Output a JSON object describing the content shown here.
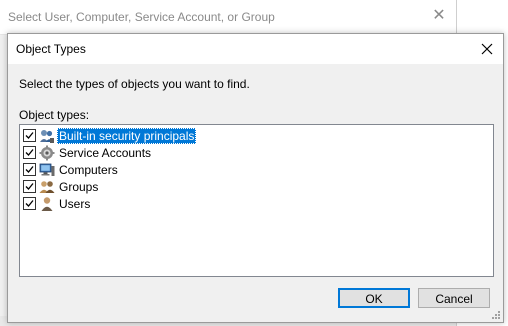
{
  "parent_window": {
    "title": "Select User, Computer, Service Account, or Group"
  },
  "dialog": {
    "title": "Object Types",
    "prompt": "Select the types of objects you want to find.",
    "list_label": "Object types:",
    "items": [
      {
        "label": "Built-in security principals",
        "checked": true,
        "selected": true,
        "icon": "security-principals-icon"
      },
      {
        "label": "Service Accounts",
        "checked": true,
        "selected": false,
        "icon": "service-accounts-icon"
      },
      {
        "label": "Computers",
        "checked": true,
        "selected": false,
        "icon": "computer-icon"
      },
      {
        "label": "Groups",
        "checked": true,
        "selected": false,
        "icon": "group-icon"
      },
      {
        "label": "Users",
        "checked": true,
        "selected": false,
        "icon": "user-icon"
      }
    ],
    "ok_label": "OK",
    "cancel_label": "Cancel"
  },
  "colors": {
    "selection": "#0078d7",
    "dialog_bg": "#f0f0f0",
    "button_bg": "#e1e1e1"
  }
}
